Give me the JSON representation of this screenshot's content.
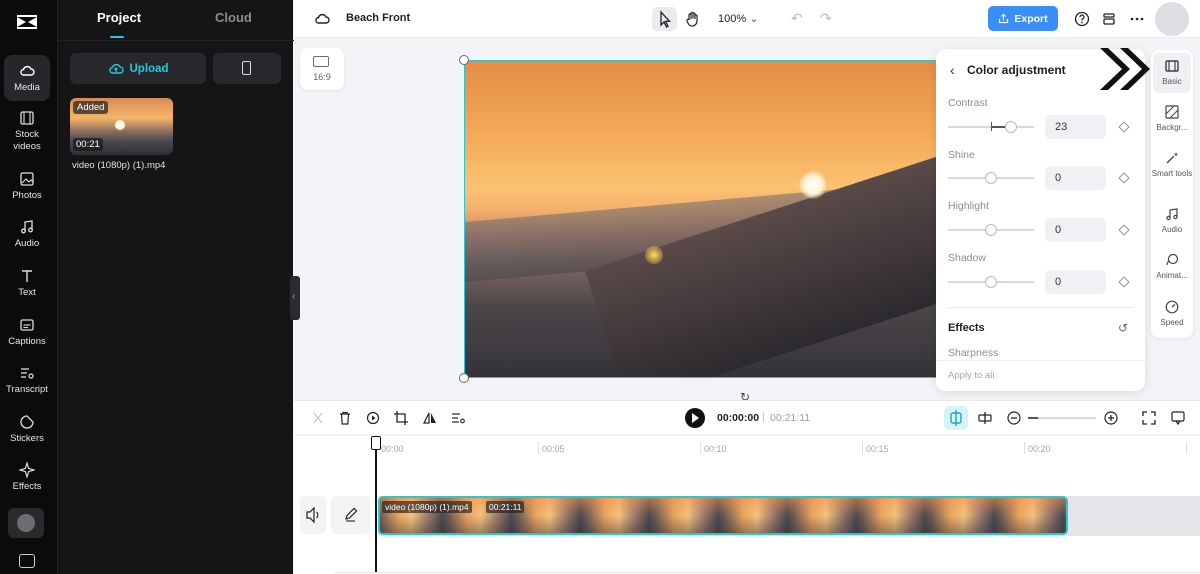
{
  "rail": {
    "items": [
      {
        "label": "Media",
        "icon": "cloud-icon"
      },
      {
        "label": "Stock videos",
        "icon": "film-icon"
      },
      {
        "label": "Photos",
        "icon": "image-icon"
      },
      {
        "label": "Audio",
        "icon": "music-note-icon"
      },
      {
        "label": "Text",
        "icon": "text-icon"
      },
      {
        "label": "Captions",
        "icon": "captions-icon"
      },
      {
        "label": "Transcript",
        "icon": "transcript-icon"
      },
      {
        "label": "Stickers",
        "icon": "sticker-icon"
      },
      {
        "label": "Effects",
        "icon": "sparkle-icon"
      }
    ]
  },
  "panel": {
    "tabs": [
      "Project",
      "Cloud"
    ],
    "upload_label": "Upload",
    "media": {
      "badge": "Added",
      "duration": "00:21",
      "name": "video (1080p) (1).mp4"
    }
  },
  "topbar": {
    "project_name": "Beach Front",
    "zoom": "100%",
    "export_label": "Export"
  },
  "canvas": {
    "ratio_label": "16:9"
  },
  "color_adjustment": {
    "title": "Color adjustment",
    "controls": [
      {
        "label": "Contrast",
        "value": "23"
      },
      {
        "label": "Shine",
        "value": "0"
      },
      {
        "label": "Highlight",
        "value": "0"
      },
      {
        "label": "Shadow",
        "value": "0"
      }
    ],
    "effects_label": "Effects",
    "sharpness_label": "Sharpness",
    "apply_all": "Apply to all"
  },
  "right_sidebar": {
    "items": [
      {
        "label": "Basic",
        "icon": "film-frame-icon"
      },
      {
        "label": "Backgr...",
        "icon": "background-icon"
      },
      {
        "label": "Smart tools",
        "icon": "magic-wand-icon"
      },
      {
        "label": "Audio",
        "icon": "music-note-icon"
      },
      {
        "label": "Animat...",
        "icon": "animation-icon"
      },
      {
        "label": "Speed",
        "icon": "speedometer-icon"
      }
    ]
  },
  "timeline": {
    "current_time": "00:00:00",
    "separator": "|",
    "total_time": "00:21:11",
    "ticks": [
      "00:00",
      "00:05",
      "00:10",
      "00:15",
      "00:20"
    ],
    "clip_name": "video (1080p) (1).mp4",
    "clip_duration": "00:21:11"
  }
}
